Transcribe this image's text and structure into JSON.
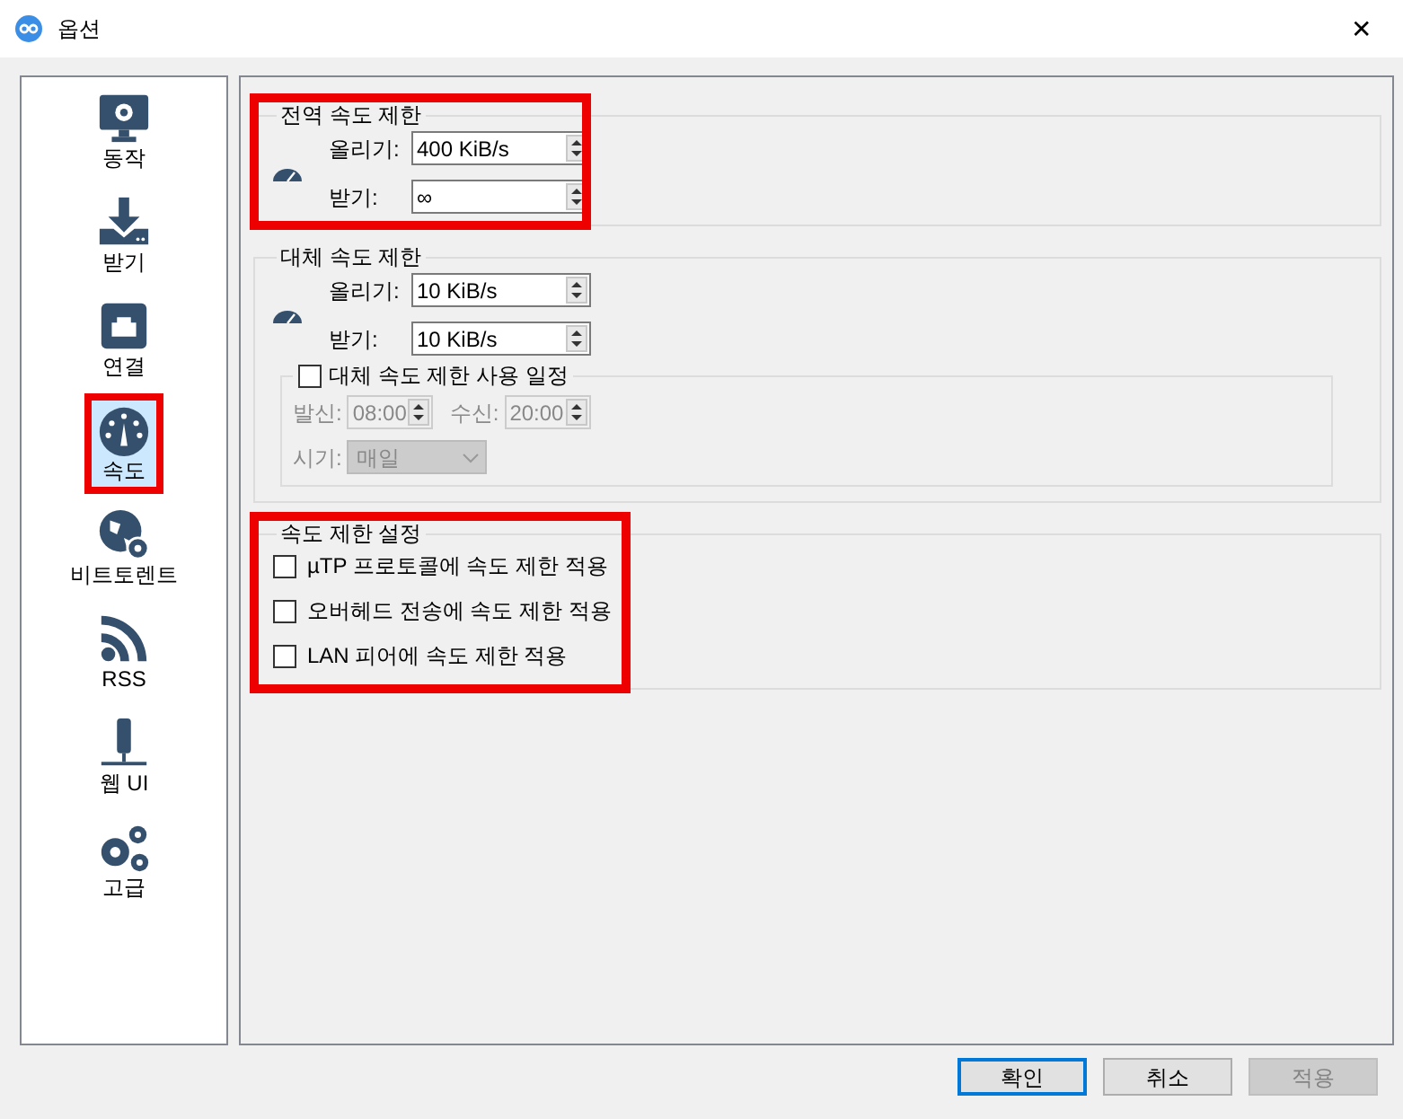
{
  "window": {
    "title": "옵션",
    "close": "✕"
  },
  "sidebar": {
    "items": [
      {
        "label": "동작",
        "selected": false,
        "highlighted": false
      },
      {
        "label": "받기",
        "selected": false,
        "highlighted": false
      },
      {
        "label": "연결",
        "selected": false,
        "highlighted": false
      },
      {
        "label": "속도",
        "selected": true,
        "highlighted": true
      },
      {
        "label": "비트토렌트",
        "selected": false,
        "highlighted": false
      },
      {
        "label": "RSS",
        "selected": false,
        "highlighted": false
      },
      {
        "label": "웹 UI",
        "selected": false,
        "highlighted": false
      },
      {
        "label": "고급",
        "selected": false,
        "highlighted": false
      }
    ]
  },
  "sections": [
    {
      "kind": "limits",
      "title": "전역 속도 제한",
      "highlighted": true,
      "fields": [
        {
          "label": "올리기:",
          "value": "400 KiB/s"
        },
        {
          "label": "받기:",
          "value": "∞"
        }
      ]
    },
    {
      "kind": "limits",
      "title": "대체 속도 제한",
      "highlighted": false,
      "fields": [
        {
          "label": "올리기:",
          "value": "10 KiB/s"
        },
        {
          "label": "받기:",
          "value": "10 KiB/s"
        }
      ],
      "schedule": {
        "label": "대체 속도 제한 사용 일정",
        "checked": false,
        "from": {
          "label": "발신:",
          "value": "08:00"
        },
        "to": {
          "label": "수신:",
          "value": "20:00"
        },
        "when": {
          "label": "시기:",
          "value": "매일"
        }
      }
    },
    {
      "kind": "options",
      "title": "속도 제한 설정",
      "highlighted": true,
      "options": [
        {
          "label": "µTP 프로토콜에 속도 제한 적용",
          "checked": false
        },
        {
          "label": "오버헤드 전송에 속도 제한 적용",
          "checked": false
        },
        {
          "label": "LAN 피어에 속도 제한 적용",
          "checked": false
        }
      ]
    }
  ],
  "buttons": [
    {
      "label": "확인",
      "default": true,
      "disabled": false
    },
    {
      "label": "취소",
      "default": false,
      "disabled": false
    },
    {
      "label": "적용",
      "default": false,
      "disabled": true
    }
  ]
}
